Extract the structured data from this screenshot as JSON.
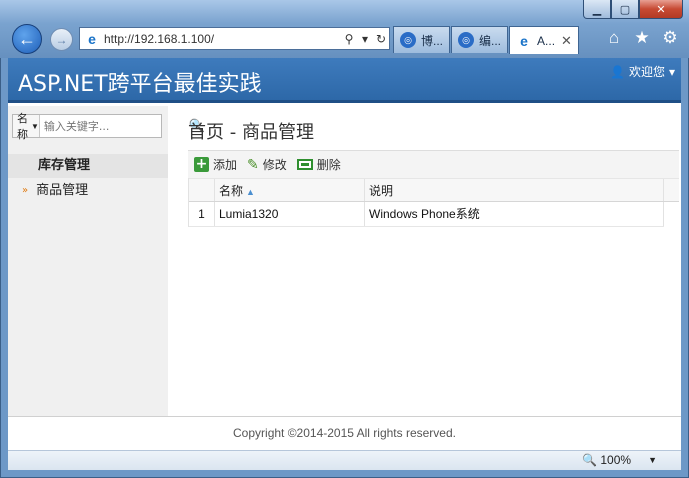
{
  "browser": {
    "address_url": "http://192.168.1.100/",
    "tabs": [
      {
        "label": "博..."
      },
      {
        "label": "编..."
      },
      {
        "label": "A..."
      }
    ]
  },
  "app": {
    "title": "ASP.NET跨平台最佳实践",
    "user_label": "欢迎您"
  },
  "sidebar": {
    "search_field": "名称",
    "search_placeholder": "输入关键字...",
    "menu_header": "库存管理",
    "items": [
      {
        "label": "商品管理"
      }
    ]
  },
  "main": {
    "breadcrumb": "首页 - 商品管理",
    "toolbar": {
      "add": "添加",
      "edit": "修改",
      "delete": "删除"
    },
    "table": {
      "columns": [
        "名称",
        "说明"
      ],
      "rows": [
        {
          "num": "1",
          "name": "Lumia1320",
          "desc": "Windows Phone系统"
        }
      ]
    }
  },
  "footer": {
    "copyright": "Copyright ©2014-2015 All rights reserved."
  },
  "statusbar": {
    "zoom": "100%"
  }
}
